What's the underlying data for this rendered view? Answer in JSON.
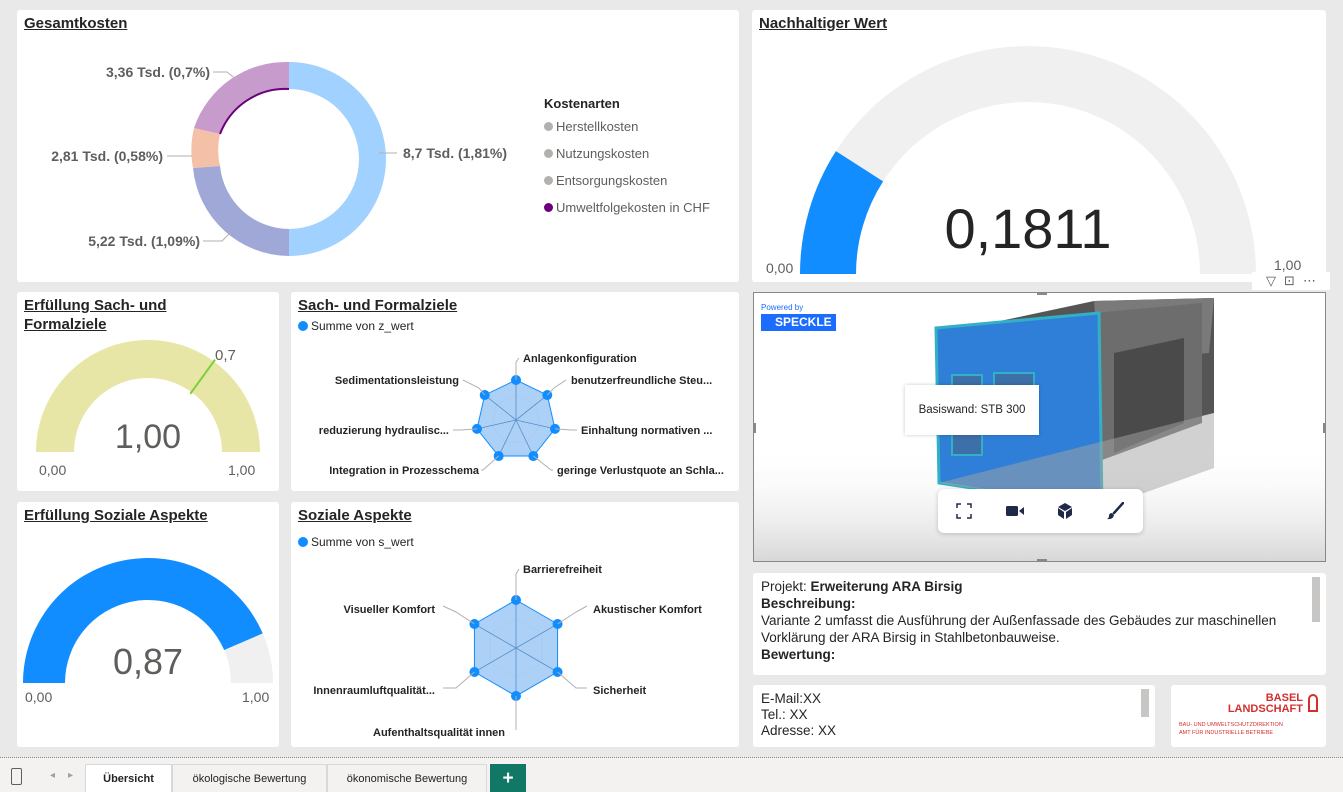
{
  "gesamtkosten": {
    "title": "Gesamtkosten",
    "legend_title": "Kostenarten",
    "legend": [
      {
        "label": "Herstellkosten",
        "color": "#b3b0ad"
      },
      {
        "label": "Nutzungskosten",
        "color": "#b3b0ad"
      },
      {
        "label": "Entsorgungskosten",
        "color": "#b3b0ad"
      },
      {
        "label": "Umweltfolgekosten in CHF",
        "color": "#6b007b"
      }
    ],
    "labels": {
      "a": "3,36 Tsd. (0,7%)",
      "b": "2,81 Tsd. (0,58%)",
      "c": "5,22 Tsd. (1,09%)",
      "d": "8,7 Tsd. (1,81%)"
    }
  },
  "nachhaltig": {
    "title": "Nachhaltiger Wert",
    "value": "0,1811",
    "min": "0,00",
    "max": "1,00",
    "fill_fraction": 0.1811,
    "fill_color": "#118dff"
  },
  "erfuellung_sach": {
    "title_line1": "Erfüllung Sach- und",
    "title_line2": "Formalziele",
    "value": "1,00",
    "min": "0,00",
    "max": "1,00",
    "target": "0,7",
    "target_fraction": 0.7,
    "fill_color": "#e8e6a6",
    "target_color": "#7ad13a"
  },
  "erfuellung_sozial": {
    "title": "Erfüllung Soziale Aspekte",
    "value": "0,87",
    "min": "0,00",
    "max": "1,00",
    "fill_fraction": 0.87,
    "fill_color": "#118dff"
  },
  "sach_radar": {
    "title": "Sach- und Formalziele",
    "series_legend": "Summe von z_wert",
    "axes": [
      "Anlagenkonfiguration",
      "benutzerfreundliche Steu...",
      "Einhaltung normativen ...",
      "geringe Verlustquote an Schla...",
      "Integration in Prozesschema",
      "reduzierung hydraulisc...",
      "Sedimentationsleistung"
    ]
  },
  "sozial_radar": {
    "title": "Soziale Aspekte",
    "series_legend": "Summe von s_wert",
    "axes": [
      "Barrierefreiheit",
      "Akustischer Komfort",
      "Sicherheit",
      "Aufenthaltsqualität innen",
      "Innenraumluftqualität...",
      "Visueller Komfort"
    ]
  },
  "viewer": {
    "powered_by": "Powered by",
    "brand": "SPECKLE",
    "tooltip": "Basiswand: STB 300"
  },
  "projekt": {
    "projekt_label": "Projekt: ",
    "projekt_name": "Erweiterung ARA Birsig",
    "beschreibung_label": "Beschreibung:",
    "beschreibung_text": "Variante 2 umfasst die Ausführung der Außenfassade des Gebäudes zur maschinellen Vorklärung der ARA Birsig in Stahlbetonbauweise.",
    "bewertung_label": "Bewertung:"
  },
  "kontakt": {
    "email": "E-Mail:XX",
    "tel_label": "Tel.: ",
    "tel_value": "XX",
    "adresse": "Adresse: XX"
  },
  "logo": {
    "line1": "BASEL",
    "line2": "LANDSCHAFT",
    "sub1": "BAU- UND UMWELTSCHUTZDIREKTION",
    "sub2": "AMT FÜR INDUSTRIELLE BETRIEBE"
  },
  "tabs": [
    {
      "label": "Übersicht",
      "active": true
    },
    {
      "label": "ökologische Bewertung",
      "active": false
    },
    {
      "label": "ökonomische Bewertung",
      "active": false
    }
  ],
  "add_tab": "+"
}
